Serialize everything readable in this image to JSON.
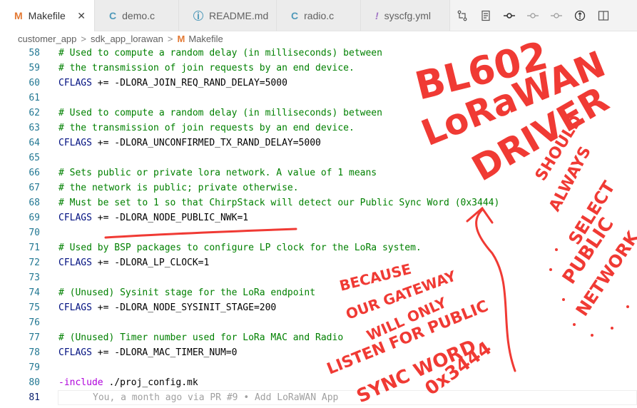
{
  "tabs": [
    {
      "icon": "M",
      "label": "Makefile",
      "active": true,
      "close": "✕"
    },
    {
      "icon": "C",
      "label": "demo.c"
    },
    {
      "icon": "i",
      "label": "README.md"
    },
    {
      "icon": "C",
      "label": "radio.c"
    },
    {
      "icon": "!",
      "label": "syscfg.yml"
    }
  ],
  "breadcrumb": {
    "items": [
      "customer_app",
      "sdk_app_lorawan"
    ],
    "file_icon": "M",
    "file": "Makefile",
    "separator": ">"
  },
  "code_lines": [
    {
      "num": "58",
      "text": "# Used to compute a random delay (in milliseconds) between",
      "kind": "comment"
    },
    {
      "num": "59",
      "text": "# the transmission of join requests by an end device.",
      "kind": "comment"
    },
    {
      "num": "60",
      "cflags": "CFLAGS",
      "rest": " += -DLORA_JOIN_REQ_RAND_DELAY=5000",
      "kind": "cflags"
    },
    {
      "num": "61",
      "text": "",
      "kind": "blank"
    },
    {
      "num": "62",
      "text": "# Used to compute a random delay (in milliseconds) between",
      "kind": "comment"
    },
    {
      "num": "63",
      "text": "# the transmission of join requests by an end device.",
      "kind": "comment"
    },
    {
      "num": "64",
      "cflags": "CFLAGS",
      "rest": " += -DLORA_UNCONFIRMED_TX_RAND_DELAY=5000",
      "kind": "cflags"
    },
    {
      "num": "65",
      "text": "",
      "kind": "blank"
    },
    {
      "num": "66",
      "text": "# Sets public or private lora network. A value of 1 means",
      "kind": "comment"
    },
    {
      "num": "67",
      "text": "# the network is public; private otherwise.",
      "kind": "comment"
    },
    {
      "num": "68",
      "text": "# Must be set to 1 so that ChirpStack will detect our Public Sync Word (0x3444)",
      "kind": "comment"
    },
    {
      "num": "69",
      "cflags": "CFLAGS",
      "rest": " += -DLORA_NODE_PUBLIC_NWK=1",
      "kind": "cflags"
    },
    {
      "num": "70",
      "text": "",
      "kind": "blank"
    },
    {
      "num": "71",
      "text": "# Used by BSP packages to configure LP clock for the LoRa system.",
      "kind": "comment"
    },
    {
      "num": "72",
      "cflags": "CFLAGS",
      "rest": " += -DLORA_LP_CLOCK=1",
      "kind": "cflags"
    },
    {
      "num": "73",
      "text": "",
      "kind": "blank"
    },
    {
      "num": "74",
      "text": "# (Unused) Sysinit stage for the LoRa endpoint",
      "kind": "comment"
    },
    {
      "num": "75",
      "cflags": "CFLAGS",
      "rest": " += -DLORA_NODE_SYSINIT_STAGE=200",
      "kind": "cflags"
    },
    {
      "num": "76",
      "text": "",
      "kind": "blank"
    },
    {
      "num": "77",
      "text": "# (Unused) Timer number used for LoRa MAC and Radio",
      "kind": "comment"
    },
    {
      "num": "78",
      "cflags": "CFLAGS",
      "rest": " += -DLORA_MAC_TIMER_NUM=0",
      "kind": "cflags"
    },
    {
      "num": "79",
      "text": "",
      "kind": "blank"
    },
    {
      "num": "80",
      "kw": "-include",
      "rest": " ./proj_config.mk",
      "kind": "include"
    },
    {
      "num": "81",
      "blame": "You, a month ago via PR #9 • Add LoRaWAN App",
      "kind": "current"
    }
  ],
  "annotations": {
    "title_lines": [
      "BL602",
      "LoRaWAN",
      "DRIVER"
    ],
    "side_note": [
      "SHOULD",
      "ALWAYS",
      "SELECT",
      "PUBLIC",
      "NETWORK"
    ],
    "reason": [
      "BECAUSE",
      "OUR GATEWAY",
      "WILL ONLY",
      "LISTEN FOR PUBLIC",
      "SYNC WORD",
      "0x3444"
    ],
    "ink_color": "#f03a34"
  }
}
